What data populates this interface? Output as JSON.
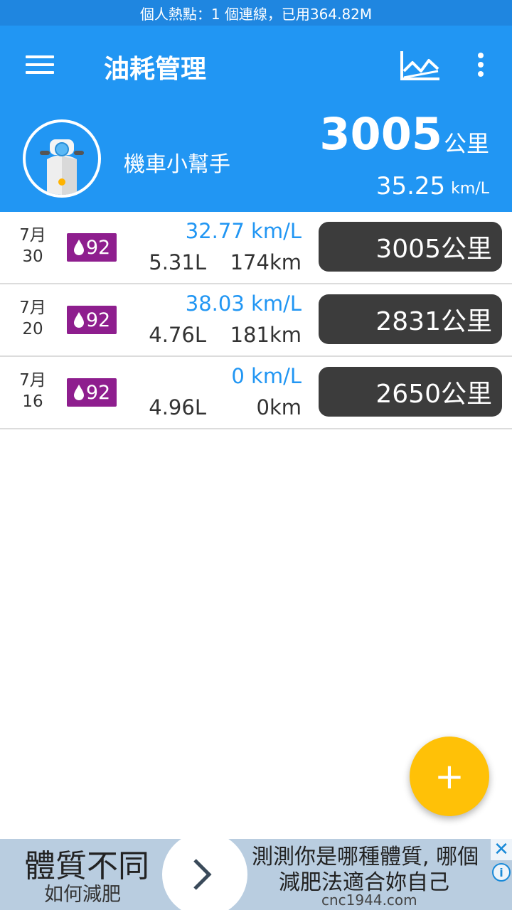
{
  "status_bar": {
    "text": "個人熱點：1 個連線，已用364.82M"
  },
  "app_bar": {
    "title": "油耗管理"
  },
  "profile": {
    "name": "機車小幫手",
    "total_km_value": "3005",
    "total_km_unit": "公里",
    "avg_eff_value": "35.25",
    "avg_eff_unit": "km/L"
  },
  "records": [
    {
      "month": "7月",
      "day": "30",
      "fuel": "92",
      "efficiency": "32.77 km/L",
      "liters": "5.31L",
      "distance": "174km",
      "odometer": "3005公里"
    },
    {
      "month": "7月",
      "day": "20",
      "fuel": "92",
      "efficiency": "38.03 km/L",
      "liters": "4.76L",
      "distance": "181km",
      "odometer": "2831公里"
    },
    {
      "month": "7月",
      "day": "16",
      "fuel": "92",
      "efficiency": "0 km/L",
      "liters": "4.96L",
      "distance": "0km",
      "odometer": "2650公里"
    }
  ],
  "fab": {
    "label": "+"
  },
  "ad": {
    "headline": "體質不同",
    "subline": "如何減肥",
    "text_line1": "測測你是哪種體質, 哪個",
    "text_line2": "減肥法適合妳自己",
    "url": "cnc1944.com",
    "close_label": "✕",
    "info_label": "i"
  },
  "colors": {
    "primary": "#2196f3",
    "status_bar": "#1f86e0",
    "fuel_badge": "#8e1e8e",
    "odometer_pill": "#3c3c3c",
    "fab": "#ffc107",
    "efficiency_text": "#2196f3"
  },
  "icons": {
    "menu": "hamburger-icon",
    "chart": "line-chart-icon",
    "more": "more-vert-icon",
    "fuel": "fuel-drop-icon",
    "add": "plus-icon",
    "ad_arrow": "chevron-right-icon"
  }
}
